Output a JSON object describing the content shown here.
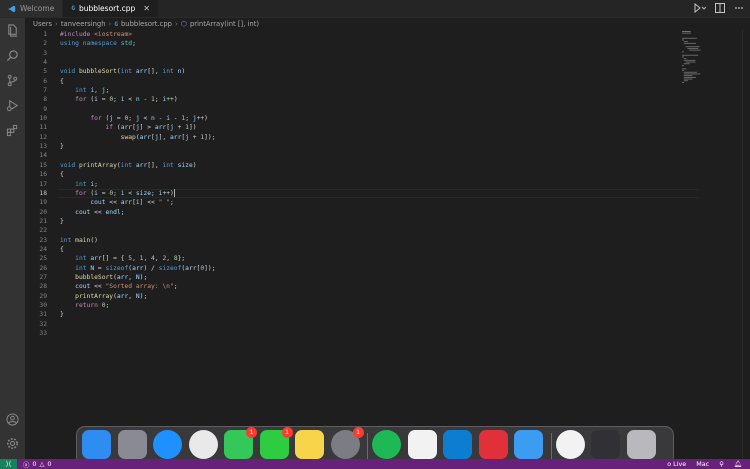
{
  "tabs": [
    {
      "label": "Welcome",
      "active": false
    },
    {
      "label": "bubblesort.cpp",
      "active": true
    }
  ],
  "breadcrumb": {
    "items": [
      "Users",
      "tanveersingh",
      "bubblesort.cpp",
      "printArray(int [], int)"
    ]
  },
  "editor": {
    "language": "cpp",
    "active_line": 18,
    "line_numbers": [
      "1",
      "2",
      "3",
      "4",
      "5",
      "6",
      "7",
      "8",
      "9",
      "10",
      "11",
      "12",
      "13",
      "14",
      "15",
      "16",
      "17",
      "18",
      "19",
      "20",
      "21",
      "22",
      "23",
      "24",
      "25",
      "26",
      "27",
      "28",
      "29",
      "30",
      "31",
      "32",
      "33"
    ],
    "lines": [
      "#include <iostream>",
      "using namespace std;",
      "",
      "",
      "void bubbleSort(int arr[], int n)",
      "{",
      "    int i, j;",
      "    for (i = 0; i < n - 1; i++)",
      "",
      "        for (j = 0; j < n - i - 1; j++)",
      "            if (arr[j] > arr[j + 1])",
      "                swap(arr[j], arr[j + 1]);",
      "}",
      "",
      "void printArray(int arr[], int size)",
      "{",
      "    int i;",
      "    for (i = 0; i < size; i++)",
      "        cout << arr[i] << \" \";",
      "    cout << endl;",
      "}",
      "",
      "int main()",
      "{",
      "    int arr[] = { 5, 1, 4, 2, 8};",
      "    int N = sizeof(arr) / sizeof(arr[0]);",
      "    bubbleSort(arr, N);",
      "    cout << \"Sorted array: \\n\";",
      "    printArray(arr, N);",
      "    return 0;",
      "}",
      "",
      ""
    ]
  },
  "statusbar": {
    "remote_icon": "remote-icon",
    "errors": "0",
    "warnings": "0",
    "live": "o Live",
    "eol": "Mac"
  },
  "dock": {
    "apps": [
      {
        "name": "finder",
        "color": "#2f8cf0"
      },
      {
        "name": "launchpad",
        "color": "#8a8a95"
      },
      {
        "name": "safari",
        "color": "#1e90ff"
      },
      {
        "name": "chrome",
        "color": "#e9e9e9"
      },
      {
        "name": "messages",
        "color": "#34c759",
        "badge": "1"
      },
      {
        "name": "facetime",
        "color": "#2ecc40",
        "badge": "1"
      },
      {
        "name": "notes",
        "color": "#f7d44a"
      },
      {
        "name": "system-settings",
        "color": "#7c7c84",
        "badge": "1"
      },
      {
        "name": "spotify",
        "color": "#1db954"
      },
      {
        "name": "pocketcasts-like",
        "color": "#f2f2f2"
      },
      {
        "name": "vscode",
        "color": "#0d7dd1"
      },
      {
        "name": "pdf-app",
        "color": "#e0313b"
      },
      {
        "name": "mail",
        "color": "#3c9cf2"
      },
      {
        "name": "network-utility",
        "color": "#f2f2f2"
      },
      {
        "name": "photo-stack",
        "color": "#303035"
      },
      {
        "name": "trash",
        "color": "#b8b8bd"
      }
    ]
  }
}
